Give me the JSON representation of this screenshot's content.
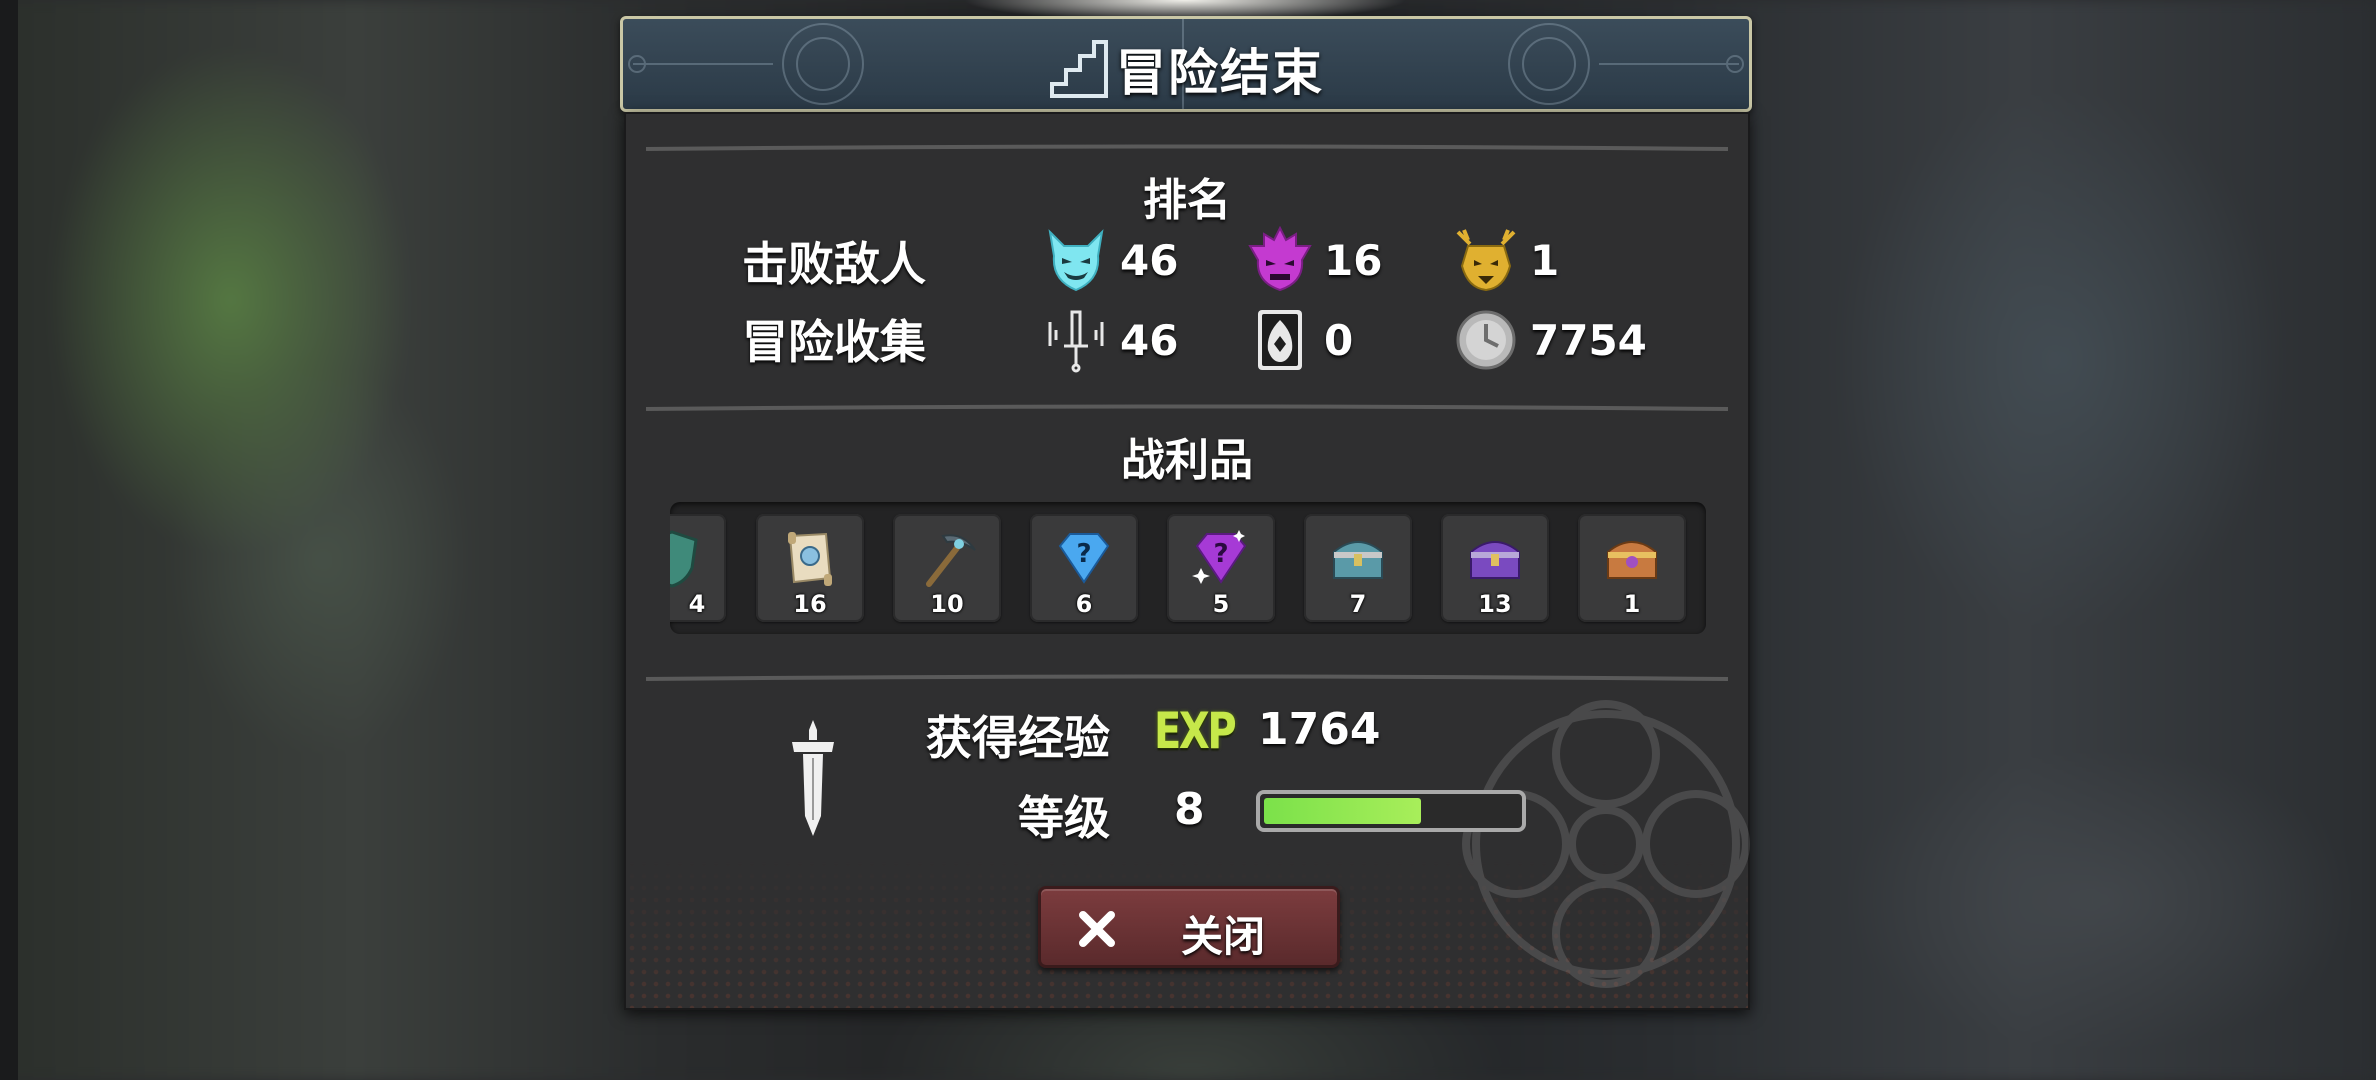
{
  "header": {
    "title": "冒险结束"
  },
  "ranking": {
    "title": "排名",
    "defeated_label": "击败敌人",
    "collected_label": "冒险收集",
    "defeated": [
      {
        "icon": "cyan-demon-icon",
        "value": "46"
      },
      {
        "icon": "purple-demon-icon",
        "value": "16"
      },
      {
        "icon": "gold-dragon-icon",
        "value": "1"
      }
    ],
    "collected": [
      {
        "icon": "sword-shrine-icon",
        "value": "46"
      },
      {
        "icon": "egg-card-icon",
        "value": "0"
      },
      {
        "icon": "silver-coin-icon",
        "value": "7754"
      }
    ]
  },
  "loot": {
    "title": "战利品",
    "items": [
      {
        "icon": "green-shield-icon",
        "count": "4"
      },
      {
        "icon": "scroll-map-icon",
        "count": "16"
      },
      {
        "icon": "pickaxe-icon",
        "count": "10"
      },
      {
        "icon": "blue-mystery-gem-icon",
        "count": "6"
      },
      {
        "icon": "purple-mystery-gem-icon",
        "count": "5"
      },
      {
        "icon": "teal-chest-icon",
        "count": "7"
      },
      {
        "icon": "purple-chest-icon",
        "count": "13"
      },
      {
        "icon": "gold-chest-icon",
        "count": "1"
      }
    ]
  },
  "experience": {
    "exp_label": "获得经验",
    "exp_badge": "EXP",
    "exp_value": "1764",
    "level_label": "等级",
    "level_value": "8",
    "level_progress": 0.62,
    "bar_color": "#7be14a"
  },
  "close_button": {
    "label": "关闭"
  },
  "colors": {
    "panel": "#2f2f30",
    "title_border": "#c9c7a6",
    "button": "#7c3c3e",
    "exp_badge": "#c6e84a"
  }
}
